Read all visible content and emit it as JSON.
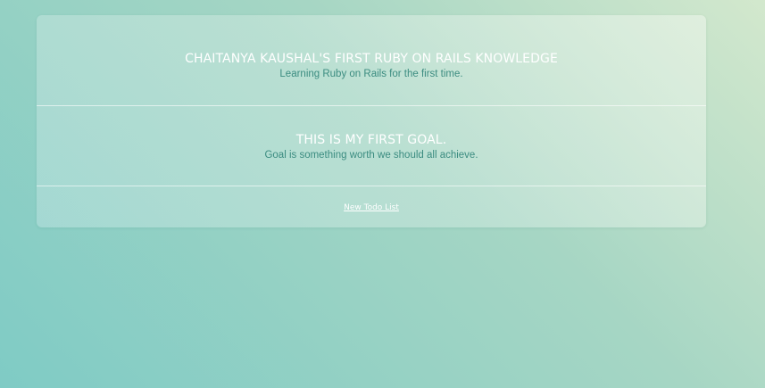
{
  "lists": [
    {
      "title": "CHAITANYA KAUSHAL'S FIRST RUBY ON RAILS KNOWLEDGE",
      "description": "Learning Ruby on Rails for the first time."
    },
    {
      "title": "THIS IS MY FIRST GOAL.",
      "description": "Goal is something worth we should all achieve."
    }
  ],
  "footer": {
    "new_link_label": "New Todo List"
  },
  "colors": {
    "title": "#ffffff",
    "description": "#3b8c80",
    "background_start": "#d3e8cd",
    "background_end": "#7fcbc5"
  }
}
